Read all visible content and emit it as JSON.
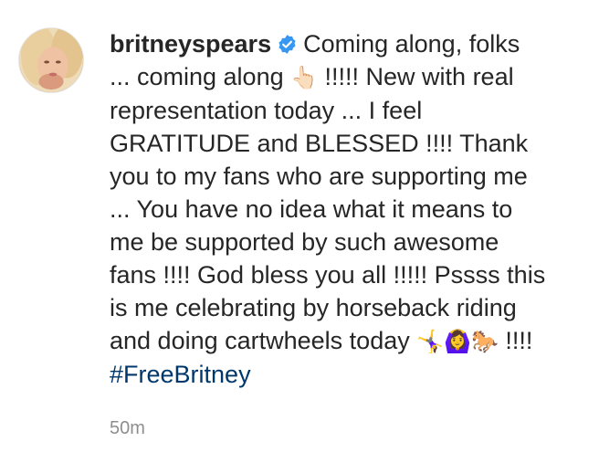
{
  "post": {
    "username": "britneyspears",
    "verified_icon": "verified-badge-icon",
    "caption_lines": [
      "Coming along, folks",
      "... coming along",
      "!!!!! New with real",
      "representation today ... I feel",
      "GRATITUDE and BLESSED !!!! Thank",
      "you to my fans who are supporting me",
      "... You have no idea what it means to",
      "me be supported by such awesome",
      "fans !!!! God bless you all !!!!! Pssss this",
      "is me celebrating by horseback riding",
      "and doing cartwheels today",
      "!!!!"
    ],
    "emojis": {
      "finger": "👆🏻",
      "celebration": "🤸‍♀️🙆‍♀️🐎"
    },
    "hashtag": "#FreeBritney",
    "timestamp": "50m"
  },
  "colors": {
    "text": "#262626",
    "hashtag": "#00376b",
    "timestamp": "#8e8e8e",
    "verified": "#3897f0"
  }
}
